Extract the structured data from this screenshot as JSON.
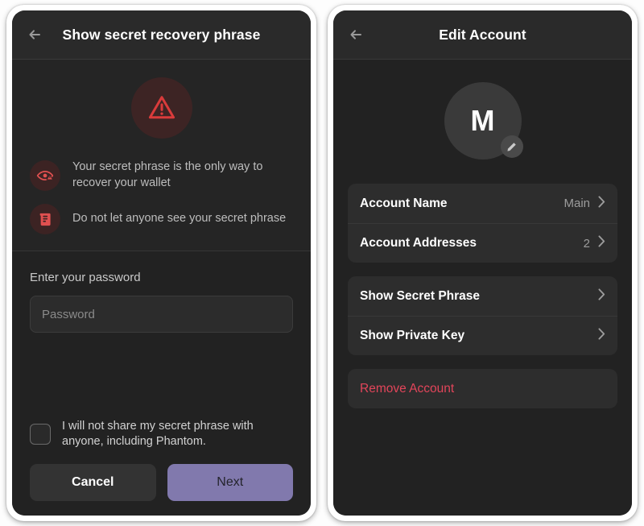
{
  "left_panel": {
    "header": {
      "back_icon": "arrow-left-icon",
      "title": "Show secret recovery phrase"
    },
    "hero_icon": "warning-triangle-icon",
    "warnings": [
      {
        "icon": "eye-warning-icon",
        "text": "Your secret phrase is the only way to recover your wallet"
      },
      {
        "icon": "scroll-document-icon",
        "text": "Do not let anyone see your secret phrase"
      }
    ],
    "password": {
      "label": "Enter your password",
      "placeholder": "Password",
      "value": ""
    },
    "consent": {
      "checked": false,
      "label": "I will not share my secret phrase with anyone, including Phantom."
    },
    "buttons": {
      "cancel": "Cancel",
      "next": "Next"
    }
  },
  "right_panel": {
    "header": {
      "back_icon": "arrow-left-icon",
      "title": "Edit Account"
    },
    "avatar": {
      "initial": "M",
      "edit_icon": "pencil-icon"
    },
    "groups": [
      {
        "rows": [
          {
            "label": "Account Name",
            "value": "Main",
            "chevron": "chevron-right-icon"
          },
          {
            "label": "Account Addresses",
            "value": "2",
            "chevron": "chevron-right-icon"
          }
        ]
      },
      {
        "rows": [
          {
            "label": "Show Secret Phrase",
            "value": "",
            "chevron": "chevron-right-icon"
          },
          {
            "label": "Show Private Key",
            "value": "",
            "chevron": "chevron-right-icon"
          }
        ]
      }
    ],
    "danger_row": {
      "label": "Remove Account"
    }
  },
  "colors": {
    "screen_bg": "#222222",
    "header_bg": "#2a2a2a",
    "card_bg": "#2d2d2d",
    "accent_purple": "#8179ad",
    "danger_red": "#e2455a",
    "warn_red": "#d93b3b"
  }
}
